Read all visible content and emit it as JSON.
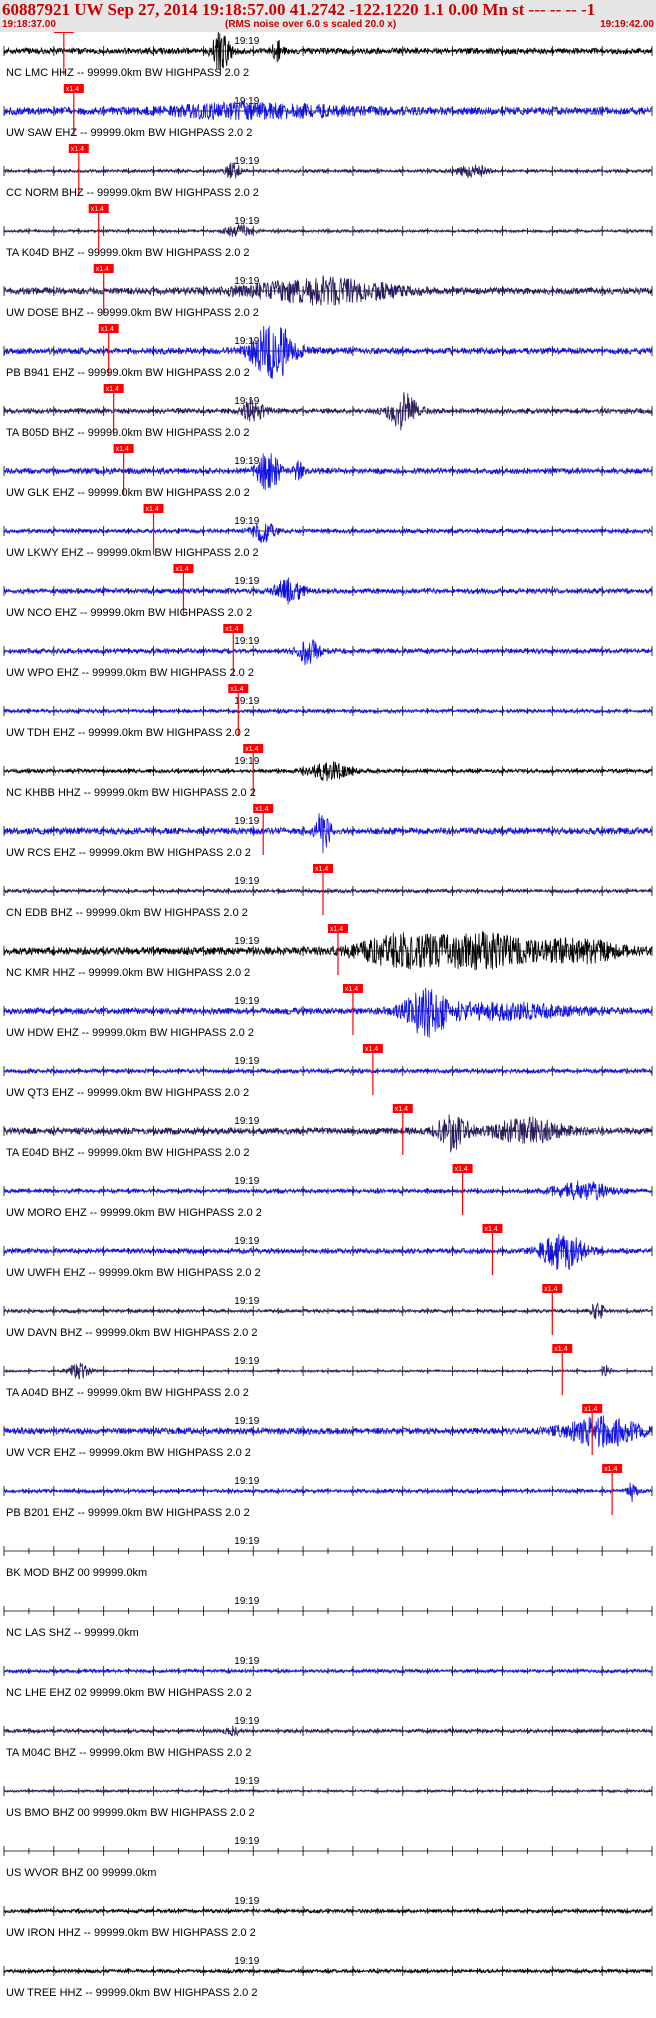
{
  "header": {
    "title": "60887921 UW Sep 27, 2014 19:18:57.00   41.2742 -122.1220  1.1 0.00 Mn st --- -- --  -1",
    "start_time": "19:18:37.00",
    "note": "(RMS noise over 6.0 s scaled 20.0 x)",
    "end_time": "19:19:42.00"
  },
  "colors": {
    "wave_blue": "#1010e6",
    "wave_navy": "#2a1a5e",
    "wave_black": "#000000",
    "pick": "#ff0000"
  },
  "chart_data": {
    "type": "line",
    "title": "60887921 UW Sep 27, 2014 19:18:57.00   41.2742 -122.1220  1.1 0.00 Mn st --- -- --  -1",
    "x_range": [
      "19:18:37.00",
      "19:19:42.00"
    ],
    "x_tick_label": "19:19",
    "x_tick_time": "19:19:00",
    "pick_label": "x1.4",
    "grid": false,
    "traces": [
      {
        "label": "NC LMC HHZ -- 99999.0km BW  HIGHPASS  2.0  2",
        "color": "black",
        "pick": "19:18:43.0",
        "amp": 14,
        "burst": [
          [
            43.6,
            1.2,
            2.6
          ]
        ],
        "spike": [
          43,
          1.2
        ]
      },
      {
        "label": "UW SAW EHZ -- 99999.0km BW  HIGHPASS  2.0  2",
        "color": "blue",
        "pick": "19:18:44.0",
        "amp": 13,
        "noise": 0.5,
        "burst": [
          [
            44.5,
            8,
            0.6
          ],
          [
            60,
            10,
            0.4
          ]
        ]
      },
      {
        "label": "CC NORM BHZ -- 99999.0km BW  HIGHPASS  2.0  2",
        "color": "navy",
        "pick": "19:18:44.5",
        "amp": 9,
        "noise": 0.3,
        "burst": [
          [
            46,
            1,
            1.5
          ],
          [
            94,
            2,
            1.2
          ]
        ]
      },
      {
        "label": "TA K04D BHZ -- 99999.0km BW  HIGHPASS  2.0  2",
        "color": "navy",
        "pick": "19:18:46.5",
        "amp": 8,
        "noise": 0.3,
        "burst": [
          [
            47,
            2,
            1.2
          ]
        ]
      },
      {
        "label": "UW DOSE BHZ -- 99999.0km BW  HIGHPASS  2.0  2",
        "color": "navy",
        "pick": "19:18:47.0",
        "amp": 16,
        "burst": [
          [
            64,
            10,
            1.2
          ]
        ]
      },
      {
        "label": "PB B941 EHZ -- 99999.0km BW  HIGHPASS  2.0  2",
        "color": "blue",
        "pick": "19:18:47.5",
        "amp": 15,
        "burst": [
          [
            54,
            3,
            3
          ]
        ]
      },
      {
        "label": "TA B05D BHZ -- 99999.0km BW  HIGHPASS  2.0  2",
        "color": "navy",
        "pick": "19:18:48.0",
        "amp": 12,
        "burst": [
          [
            50,
            1.5,
            1.5
          ],
          [
            80,
            2,
            2.5
          ]
        ]
      },
      {
        "label": "UW GLK EHZ -- 99999.0km BW  HIGHPASS  2.0  2",
        "color": "blue",
        "pick": "19:18:49.0",
        "amp": 12,
        "noise": 0.4,
        "burst": [
          [
            53,
            1.5,
            2.8
          ],
          [
            59,
            0.6,
            1.5
          ]
        ]
      },
      {
        "label": "UW LKWY EHZ -- 99999.0km BW  HIGHPASS  2.0  2",
        "color": "blue",
        "pick": "19:18:52.0",
        "amp": 10,
        "burst": [
          [
            52,
            1.5,
            1.8
          ]
        ]
      },
      {
        "label": "UW NCO EHZ -- 99999.0km BW  HIGHPASS  2.0  2",
        "color": "blue",
        "pick": "19:18:55.0",
        "amp": 12,
        "burst": [
          [
            57,
            2,
            1.6
          ]
        ]
      },
      {
        "label": "UW WPO EHZ -- 99999.0km BW  HIGHPASS  2.0  2",
        "color": "blue",
        "pick": "19:19:00.0",
        "amp": 10,
        "noise": 0.4,
        "burst": [
          [
            61,
            1.5,
            2.2
          ]
        ]
      },
      {
        "label": "UW TDH EHZ -- 99999.0km BW  HIGHPASS  2.0  2",
        "color": "blue",
        "pick": "19:19:00.5",
        "amp": 8,
        "noise": 0.4,
        "burst": []
      },
      {
        "label": "NC KHBB HHZ -- 99999.0km BW  HIGHPASS  2.0  2",
        "color": "black",
        "pick": "19:19:02.0",
        "amp": 9,
        "burst": [
          [
            65,
            3,
            1.6
          ]
        ]
      },
      {
        "label": "UW RCS EHZ -- 99999.0km BW  HIGHPASS  2.0  2",
        "color": "blue",
        "pick": "19:19:03.0",
        "amp": 14,
        "noise": 0.4,
        "burst": [
          [
            64,
            1,
            2.4
          ]
        ]
      },
      {
        "label": "CN EDB BHZ -- 99999.0km BW  HIGHPASS  2.0  2",
        "color": "navy",
        "pick": "19:19:09.0",
        "amp": 6,
        "noise": 0.5,
        "burst": []
      },
      {
        "label": "NC KMR HHZ -- 99999.0km BW  HIGHPASS  2.0  2",
        "color": "black",
        "pick": "19:19:10.5",
        "amp": 18,
        "burst": [
          [
            80,
            6,
            1.4
          ],
          [
            96,
            6,
            1.5
          ],
          [
            115,
            6,
            1
          ]
        ]
      },
      {
        "label": "UW HDW EHZ -- 99999.0km BW  HIGHPASS  2.0  2",
        "color": "blue",
        "pick": "19:19:12.0",
        "amp": 15,
        "burst": [
          [
            85,
            3,
            2.5
          ],
          [
            100,
            10,
            0.8
          ]
        ]
      },
      {
        "label": "UW QT3 EHZ -- 99999.0km BW  HIGHPASS  2.0  2",
        "color": "blue",
        "pick": "19:19:14.0",
        "amp": 9,
        "noise": 0.4,
        "burst": []
      },
      {
        "label": "TA E04D BHZ -- 99999.0km BW  HIGHPASS  2.0  2",
        "color": "navy",
        "pick": "19:19:17.0",
        "amp": 16,
        "burst": [
          [
            90,
            2,
            2
          ],
          [
            105,
            5,
            1.2
          ]
        ]
      },
      {
        "label": "UW MORO EHZ -- 99999.0km BW  HIGHPASS  2.0  2",
        "color": "blue",
        "pick": "19:19:23.0",
        "amp": 10,
        "burst": [
          [
            116,
            4,
            1.5
          ]
        ]
      },
      {
        "label": "UW UWFH EHZ -- 99999.0km BW  HIGHPASS  2.0  2",
        "color": "blue",
        "pick": "19:19:26.0",
        "amp": 12,
        "burst": [
          [
            112,
            3,
            2.5
          ]
        ]
      },
      {
        "label": "UW DAVN BHZ -- 99999.0km BW  HIGHPASS  2.0  2",
        "color": "navy",
        "pick": "19:19:32.0",
        "amp": 7,
        "noise": 0.4,
        "burst": [
          [
            119,
            1,
            2
          ]
        ]
      },
      {
        "label": "TA A04D BHZ -- 99999.0km BW  HIGHPASS  2.0  2",
        "color": "navy",
        "pick": "19:19:33.0",
        "amp": 9,
        "noise": 0.2,
        "burst": [
          [
            15,
            1.5,
            1.5
          ],
          [
            121,
            0.5,
            1.5
          ]
        ]
      },
      {
        "label": "UW VCR EHZ -- 99999.0km BW  HIGHPASS  2.0  2",
        "color": "blue",
        "pick": "19:19:36.0",
        "amp": 15,
        "burst": [
          [
            120,
            5,
            1.6
          ]
        ]
      },
      {
        "label": "PB B201 EHZ -- 99999.0km BW  HIGHPASS  2.0  2",
        "color": "blue",
        "pick": "19:19:38.0",
        "amp": 8,
        "noise": 0.4,
        "burst": [
          [
            126,
            0.6,
            2
          ]
        ]
      },
      {
        "label": "BK MOD BHZ 00 99999.0km",
        "color": "none",
        "amp": 0
      },
      {
        "label": "NC LAS SHZ -- 99999.0km",
        "color": "none",
        "amp": 0
      },
      {
        "label": "NC LHE EHZ 02 99999.0km BW  HIGHPASS  2.0  2",
        "color": "blue",
        "amp": 3,
        "noise": 1
      },
      {
        "label": "TA M04C BHZ -- 99999.0km BW  HIGHPASS  2.0  2",
        "color": "navy",
        "amp": 3,
        "noise": 1,
        "burst": [
          [
            46,
            1,
            2
          ]
        ]
      },
      {
        "label": "US BMO BHZ 00 99999.0km BW  HIGHPASS  2.0  2",
        "color": "navy",
        "amp": 2,
        "noise": 1
      },
      {
        "label": "US WVOR BHZ 00 99999.0km",
        "color": "none",
        "amp": 0
      },
      {
        "label": "UW IRON HHZ -- 99999.0km BW  HIGHPASS  2.0  2",
        "color": "black",
        "amp": 3,
        "noise": 1
      },
      {
        "label": "UW TREE HHZ -- 99999.0km BW  HIGHPASS  2.0  2",
        "color": "black",
        "amp": 3,
        "noise": 1
      }
    ]
  }
}
